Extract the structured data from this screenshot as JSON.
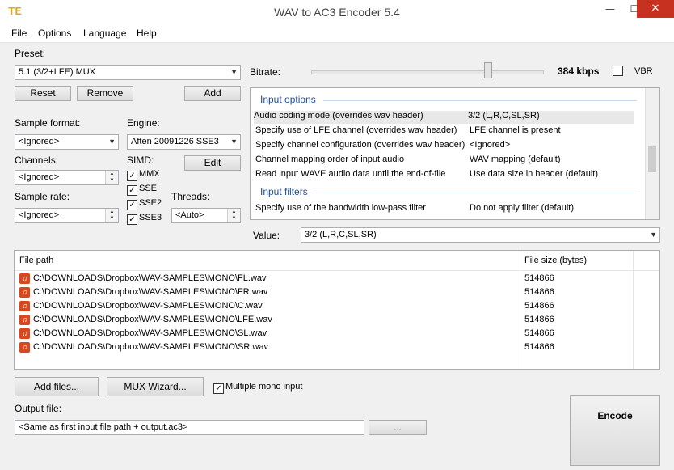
{
  "window": {
    "title": "WAV to AC3 Encoder 5.4",
    "app_icon_glyph": "TE",
    "minimize": "—",
    "maximize": "☐",
    "close": "✕"
  },
  "menu": {
    "file": "File",
    "options": "Options",
    "language": "Language",
    "help": "Help"
  },
  "preset": {
    "label": "Preset:",
    "value": "5.1 (3/2+LFE) MUX",
    "reset": "Reset",
    "remove": "Remove",
    "add": "Add"
  },
  "bitrate": {
    "label": "Bitrate:",
    "value": "384 kbps",
    "vbr_label": "VBR",
    "vbr_checked": false,
    "slider_level": 0.76
  },
  "sample_format": {
    "label": "Sample format:",
    "value": "<Ignored>"
  },
  "engine": {
    "label": "Engine:",
    "value": "Aften 20091226 SSE3"
  },
  "channels": {
    "label": "Channels:",
    "value": "<Ignored>"
  },
  "simd": {
    "label": "SIMD:",
    "edit": "Edit",
    "mmx": "MMX",
    "sse": "SSE",
    "sse2": "SSE2",
    "sse3": "SSE3",
    "check_glyph": "✓"
  },
  "sample_rate": {
    "label": "Sample rate:",
    "value": "<Ignored>"
  },
  "threads": {
    "label": "Threads:",
    "value": "<Auto>"
  },
  "options_panel": {
    "group_input": "Input options",
    "rows": [
      {
        "key": "Audio coding mode (overrides wav header)",
        "value": "3/2 (L,R,C,SL,SR)"
      },
      {
        "key": "Specify use of LFE channel (overrides wav header)",
        "value": "LFE channel is present"
      },
      {
        "key": "Specify channel configuration (overrides wav header)",
        "value": "<Ignored>"
      },
      {
        "key": "Channel mapping order of input audio",
        "value": "WAV mapping (default)"
      },
      {
        "key": "Read input WAVE audio data until the end-of-file",
        "value": "Use data size in header (default)"
      }
    ],
    "group_filters": "Input filters",
    "filter_rows": [
      {
        "key": "Specify use of the bandwidth low-pass filter",
        "value": "Do not apply filter (default)"
      }
    ]
  },
  "value_field": {
    "label": "Value:",
    "value": "3/2 (L,R,C,SL,SR)"
  },
  "file_list": {
    "col_path": "File path",
    "col_size": "File size (bytes)",
    "rows": [
      {
        "path": "C:\\DOWNLOADS\\Dropbox\\WAV-SAMPLES\\MONO\\FL.wav",
        "size": "514866"
      },
      {
        "path": "C:\\DOWNLOADS\\Dropbox\\WAV-SAMPLES\\MONO\\FR.wav",
        "size": "514866"
      },
      {
        "path": "C:\\DOWNLOADS\\Dropbox\\WAV-SAMPLES\\MONO\\C.wav",
        "size": "514866"
      },
      {
        "path": "C:\\DOWNLOADS\\Dropbox\\WAV-SAMPLES\\MONO\\LFE.wav",
        "size": "514866"
      },
      {
        "path": "C:\\DOWNLOADS\\Dropbox\\WAV-SAMPLES\\MONO\\SL.wav",
        "size": "514866"
      },
      {
        "path": "C:\\DOWNLOADS\\Dropbox\\WAV-SAMPLES\\MONO\\SR.wav",
        "size": "514866"
      }
    ]
  },
  "actions": {
    "add_files": "Add files...",
    "mux_wizard": "MUX Wizard...",
    "multiple_mono": "Multiple mono input",
    "encode": "Encode",
    "browse": "..."
  },
  "output": {
    "label": "Output file:",
    "value": "<Same as first input file path + output.ac3>"
  },
  "icons": {
    "combo_arrow": "▼",
    "spin_up": "▲",
    "spin_down": "▼",
    "file_glyph": "♫"
  }
}
